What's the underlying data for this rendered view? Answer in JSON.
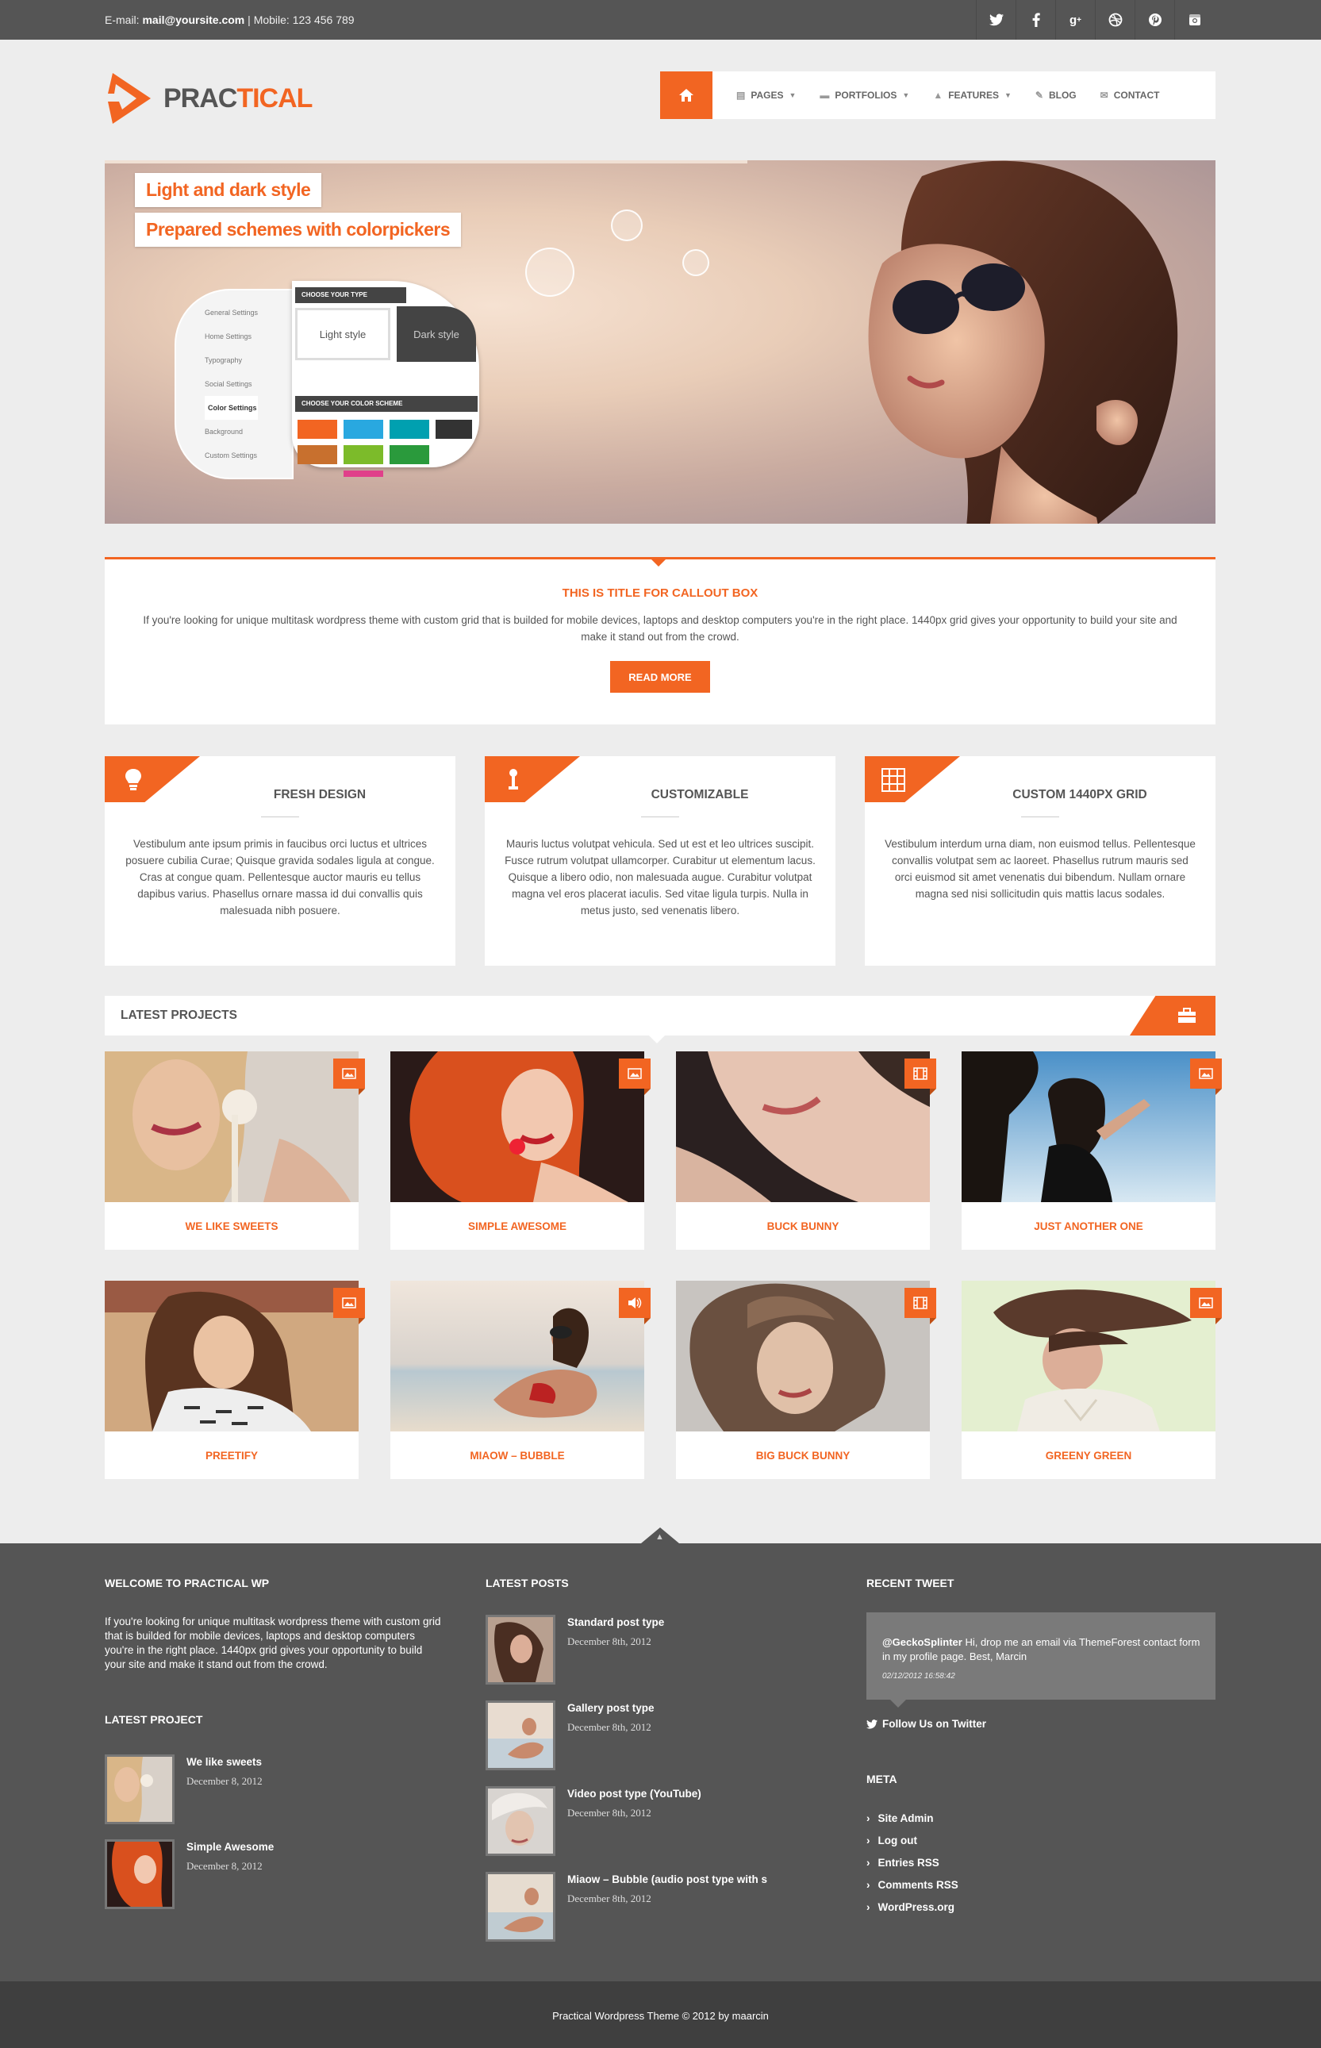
{
  "topbar": {
    "email_label": "E-mail:",
    "email": "mail@yoursite.com",
    "separator": "|",
    "mobile": "Mobile: 123 456 789",
    "social": [
      "twitter-icon",
      "facebook-icon",
      "google-plus-icon",
      "dribbble-icon",
      "pinterest-icon",
      "instagram-icon"
    ]
  },
  "logo": {
    "part1": "PRAC",
    "part2": "TICAL"
  },
  "nav": {
    "items": [
      {
        "label": "Pages",
        "icon": "pages-icon",
        "has_dropdown": true
      },
      {
        "label": "Portfolios",
        "icon": "portfolio-icon",
        "has_dropdown": true
      },
      {
        "label": "Features",
        "icon": "flask-icon",
        "has_dropdown": true
      },
      {
        "label": "Blog",
        "icon": "pencil-icon",
        "has_dropdown": false
      },
      {
        "label": "Contact",
        "icon": "envelope-icon",
        "has_dropdown": false
      }
    ]
  },
  "hero": {
    "tag1": "Light and dark style",
    "tag2": "Prepared schemes with colorpickers",
    "panel": {
      "menu": [
        "General Settings",
        "Home Settings",
        "Typography",
        "Social Settings",
        "Color Settings",
        "Background",
        "Custom Settings"
      ],
      "choose_type": "CHOOSE YOUR TYPE",
      "light": "Light style",
      "dark": "Dark style",
      "choose_scheme": "CHOOSE YOUR COLOR SCHEME",
      "swatches": [
        "#f26522",
        "#29a8e0",
        "#00a0b0",
        "#333333",
        "#c8702e",
        "#7cbb2a",
        "#2a9a3c",
        "#e0408a"
      ]
    }
  },
  "callout": {
    "title": "This is title for callout box",
    "text": "If you're looking for unique multitask wordpress theme with custom grid that is builded for mobile devices, laptops and desktop computers you're in the right place. 1440px grid gives your opportunity to build your site and make it stand out from the crowd.",
    "button": "Read More"
  },
  "features": [
    {
      "title": "Fresh Design",
      "icon": "lightbulb-icon",
      "text": "Vestibulum ante ipsum primis in faucibus orci luctus et ultrices posuere cubilia Curae; Quisque gravida sodales ligula at congue. Cras at congue quam. Pellentesque auctor mauris eu tellus dapibus varius. Phasellus ornare massa id dui convallis quis malesuada nibh posuere."
    },
    {
      "title": "Customizable",
      "icon": "thermometer-icon",
      "text": "Mauris luctus volutpat vehicula. Sed ut est et leo ultrices suscipit. Fusce rutrum volutpat ullamcorper. Curabitur ut elementum lacus. Quisque a libero odio, non malesuada augue. Curabitur volutpat magna vel eros placerat iaculis. Sed vitae ligula turpis. Nulla in metus justo, sed venenatis libero."
    },
    {
      "title": "Custom 1440px Grid",
      "icon": "grid-icon",
      "text": "Vestibulum interdum urna diam, non euismod tellus. Pellentesque convallis volutpat sem ac laoreet. Phasellus rutrum mauris sed orci euismod sit amet venenatis dui bibendum. Nullam ornare magna sed nisi sollicitudin quis mattis lacus sodales."
    }
  ],
  "projects": {
    "title": "Latest Projects",
    "badge_icon": "briefcase-icon",
    "items": [
      {
        "label": "We like sweets",
        "icon": "image-icon"
      },
      {
        "label": "Simple Awesome",
        "icon": "image-icon"
      },
      {
        "label": "Buck Bunny",
        "icon": "film-icon"
      },
      {
        "label": "Just another one",
        "icon": "image-icon"
      },
      {
        "label": "Preetify",
        "icon": "image-icon"
      },
      {
        "label": "Miaow – Bubble",
        "icon": "speaker-icon"
      },
      {
        "label": "Big Buck Bunny",
        "icon": "film-icon"
      },
      {
        "label": "Greeny Green",
        "icon": "image-icon"
      }
    ]
  },
  "footer": {
    "welcome_title": "Welcome to Practical WP",
    "welcome_text": "If you're looking for unique multitask wordpress theme with custom grid that is builded for mobile devices, laptops and desktop computers you're in the right place. 1440px grid gives your opportunity to build your site and make it stand out from the crowd.",
    "latest_project_title": "Latest Project",
    "latest_project": [
      {
        "title": "We like sweets",
        "date": "December 8, 2012"
      },
      {
        "title": "Simple Awesome",
        "date": "December 8, 2012"
      }
    ],
    "latest_posts_title": "Latest Posts",
    "latest_posts": [
      {
        "title": "Standard post type",
        "date": "December 8th, 2012"
      },
      {
        "title": "Gallery post type",
        "date": "December 8th, 2012"
      },
      {
        "title": "Video post type (YouTube)",
        "date": "December 8th, 2012"
      },
      {
        "title": "Miaow – Bubble (audio post type with s",
        "date": "December 8th, 2012"
      }
    ],
    "recent_tweet_title": "Recent Tweet",
    "tweet": {
      "handle": "@GeckoSplinter",
      "text": " Hi, drop me an email via ThemeForest contact form in my profile page. Best, Marcin",
      "time": "02/12/2012 16:58:42"
    },
    "follow": "Follow Us on Twitter",
    "meta_title": "Meta",
    "meta": [
      "Site Admin",
      "Log out",
      "Entries RSS",
      "Comments RSS",
      "WordPress.org"
    ],
    "copyright": "Practical Wordpress Theme © 2012 by maarcin"
  },
  "colors": {
    "accent": "#f26522",
    "dark": "#555555",
    "footer_bottom": "#3f3f3f",
    "bg": "#ededed"
  }
}
